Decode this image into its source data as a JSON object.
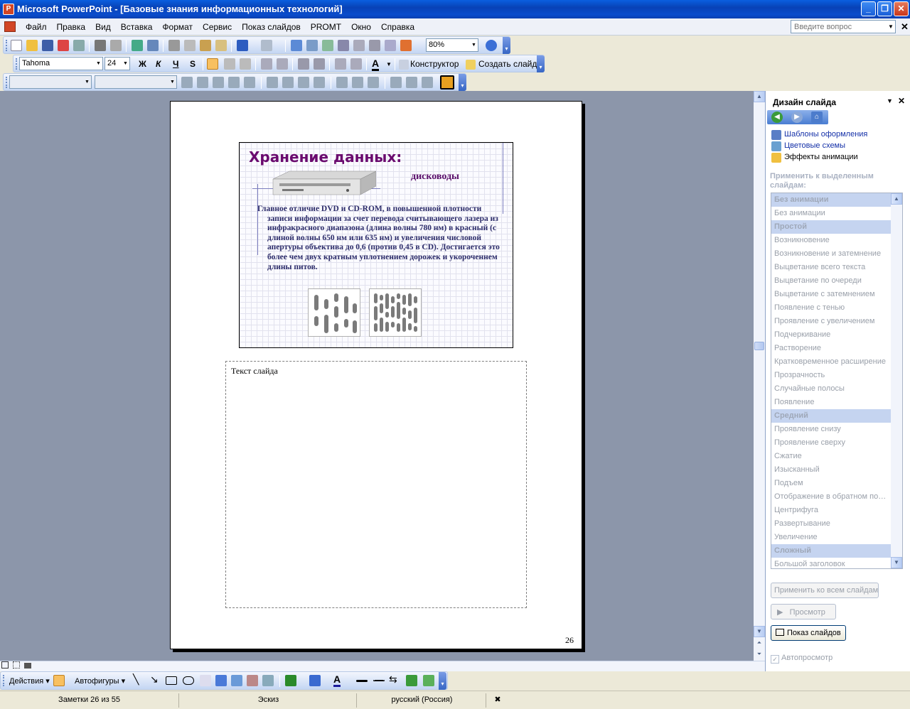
{
  "window": {
    "title": "Microsoft PowerPoint - [Базовые знания информационных технологий]",
    "controls": [
      "_",
      "❐",
      "✕"
    ]
  },
  "menu": {
    "items": [
      "Файл",
      "Правка",
      "Вид",
      "Вставка",
      "Формат",
      "Сервис",
      "Показ слайдов",
      "PROMT",
      "Окно",
      "Справка"
    ],
    "ask_placeholder": "Введите вопрос"
  },
  "toolbar_standard": {
    "zoom": "80%"
  },
  "toolbar_format": {
    "font": "Tahoma",
    "size": "24",
    "bold": "Ж",
    "italic": "К",
    "underline": "Ч",
    "shadow": "S",
    "font_color_letter": "A",
    "designer_label": "Конструктор",
    "new_slide_label": "Создать слайд"
  },
  "slide": {
    "title": "Хранение данных",
    "title_colon": ":",
    "subtitle": "дисководы",
    "body": "Главное отличие DVD и CD-ROM, в повышенной плотности записи информации за счет перевода считывающего лазера из инфракрасного диапазона (длина волны 780 нм) в красный (с длиной волны 650 нм или 635 нм) и увеличения числовой апертуры объектива до 0,6 (против 0,45 в CD). Достигается это более чем двух кратным уплотнением дорожек и укороченнем длины питов."
  },
  "notes": {
    "placeholder": "Текст слайда",
    "page_number": "26"
  },
  "taskpane": {
    "title": "Дизайн слайда",
    "links": [
      "Шаблоны оформления",
      "Цветовые схемы",
      "Эффекты анимации"
    ],
    "apply_label": "Применить к выделенным слайдам:",
    "animations": [
      {
        "label": "Без анимации",
        "category": true
      },
      {
        "label": "Без анимации",
        "category": false
      },
      {
        "label": "Простой",
        "category": true
      },
      {
        "label": "Возникновение",
        "category": false
      },
      {
        "label": "Возникновение и затемнение",
        "category": false
      },
      {
        "label": "Выцветание всего текста",
        "category": false
      },
      {
        "label": "Выцветание по очереди",
        "category": false
      },
      {
        "label": "Выцветание с затемнением",
        "category": false
      },
      {
        "label": "Появление с тенью",
        "category": false
      },
      {
        "label": "Проявление с увеличением",
        "category": false
      },
      {
        "label": "Подчеркивание",
        "category": false
      },
      {
        "label": "Растворение",
        "category": false
      },
      {
        "label": "Кратковременное расширение",
        "category": false
      },
      {
        "label": "Прозрачность",
        "category": false
      },
      {
        "label": "Случайные полосы",
        "category": false
      },
      {
        "label": "Появление",
        "category": false
      },
      {
        "label": "Средний",
        "category": true
      },
      {
        "label": "Проявление снизу",
        "category": false
      },
      {
        "label": "Проявление сверху",
        "category": false
      },
      {
        "label": "Сжатие",
        "category": false
      },
      {
        "label": "Изысканный",
        "category": false
      },
      {
        "label": "Подъем",
        "category": false
      },
      {
        "label": "Отображение в обратном по…",
        "category": false
      },
      {
        "label": "Центрифуга",
        "category": false
      },
      {
        "label": "Развертывание",
        "category": false
      },
      {
        "label": "Увеличение",
        "category": false
      },
      {
        "label": "Сложный",
        "category": true
      },
      {
        "label": "Большой заголовок",
        "category": false
      }
    ],
    "apply_all_button": "Применить ко всем слайдам",
    "preview_button": "Просмотр",
    "slideshow_button": "Показ слайдов",
    "autopreview_label": "Автопросмотр"
  },
  "drawing_toolbar": {
    "actions_label": "Действия",
    "autoshapes_label": "Автофигуры"
  },
  "status": {
    "notes_position": "Заметки 26 из 55",
    "design": "Эскиз",
    "language": "русский (Россия)"
  },
  "colors": {
    "title_bar": "#0842b7",
    "slide_title": "#6a0a6e",
    "link": "#1430a8"
  }
}
